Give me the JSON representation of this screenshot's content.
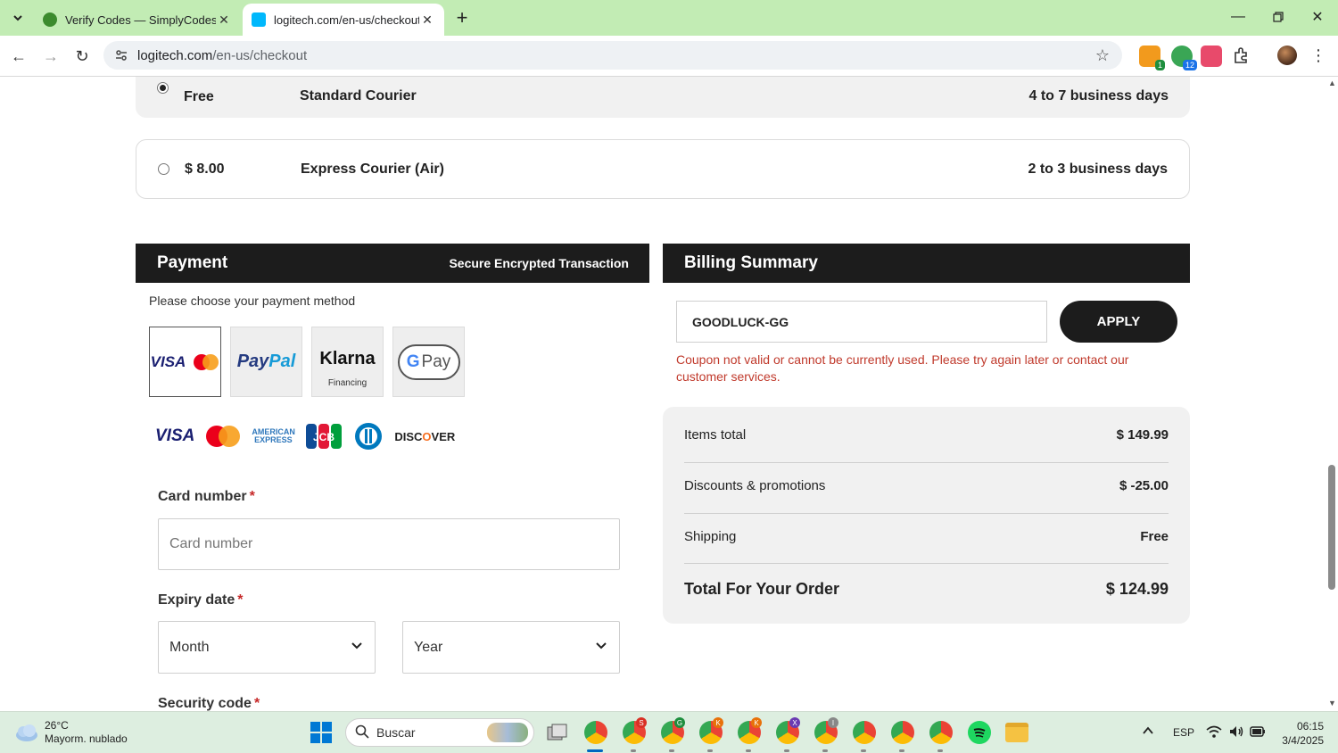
{
  "browser": {
    "tabs": [
      {
        "title": "Verify Codes — SimplyCodes",
        "active": false
      },
      {
        "title": "logitech.com/en-us/checkout",
        "active": true
      }
    ],
    "url_host": "logitech.com",
    "url_path": "/en-us/checkout",
    "extension_badges": [
      "1",
      "12"
    ]
  },
  "shipping": {
    "options": [
      {
        "price": "Free",
        "name": "Standard Courier",
        "days": "4 to 7 business days",
        "selected": true
      },
      {
        "price": "$ 8.00",
        "name": "Express Courier (Air)",
        "days": "2 to 3 business days",
        "selected": false
      }
    ]
  },
  "payment": {
    "title": "Payment",
    "secure_label": "Secure Encrypted Transaction",
    "choose_label": "Please choose your payment method",
    "methods": [
      {
        "name": "card-icon",
        "selected": true
      },
      {
        "name": "PayPal",
        "selected": false
      },
      {
        "name": "Klarna",
        "sub": "Financing",
        "selected": false
      },
      {
        "name": "G Pay",
        "selected": false
      }
    ],
    "card_brands": [
      "VISA",
      "mastercard",
      "AMERICAN EXPRESS",
      "JCB",
      "diners",
      "DISCOVER"
    ],
    "card_number_label": "Card number",
    "card_number_placeholder": "Card number",
    "expiry_label": "Expiry date",
    "month_label": "Month",
    "year_label": "Year",
    "security_label": "Security code",
    "required_mark": "*"
  },
  "billing": {
    "title": "Billing Summary",
    "coupon_value": "GOODLUCK-GG",
    "apply_label": "APPLY",
    "error": "Coupon not valid or cannot be currently used. Please try again later or contact our customer services.",
    "rows": [
      {
        "label": "Items total",
        "value": "$ 149.99"
      },
      {
        "label": "Discounts & promotions",
        "value": "$ -25.00"
      },
      {
        "label": "Shipping",
        "value": "Free"
      }
    ],
    "total_label": "Total For Your Order",
    "total_value": "$ 124.99"
  },
  "taskbar": {
    "temperature": "26°C",
    "weather": "Mayorm. nublado",
    "search_label": "Buscar",
    "lang": "ESP",
    "time": "06:15",
    "date": "3/4/2025"
  },
  "colors": {
    "tabbar": "#c2ecb4",
    "dark_panel": "#1c1c1c",
    "error_red": "#c0392b",
    "required_red": "#c62828"
  }
}
